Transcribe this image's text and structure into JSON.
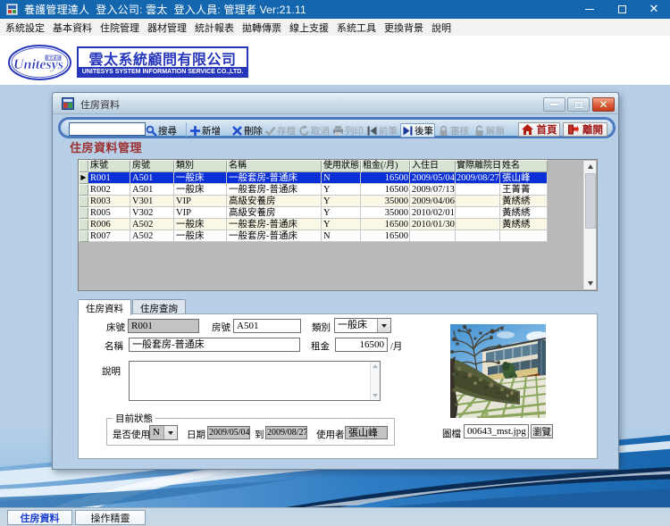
{
  "os": {
    "title": "養護管理達人  登入公司: 雲太  登入人員: 管理者 Ver:21.11",
    "controls": {
      "minimize": "minimize",
      "maximize": "maximize",
      "close": "close"
    }
  },
  "menu": {
    "items": [
      "系統設定",
      "基本資料",
      "住院管理",
      "器材管理",
      "統計報表",
      "拋轉傳票",
      "線上支援",
      "系統工具",
      "更換背景",
      "說明"
    ]
  },
  "brand": {
    "logo_script": "Unitesys",
    "logo_small": "雲太系統",
    "company_zh": "雲太系統顧問有限公司",
    "company_en": "UNITESYS SYSTEM INFORMATION SERVICE CO.,LTD."
  },
  "mdi": {
    "title": "住房資料",
    "heading": "住房資料管理",
    "toolbar": {
      "search": "搜尋",
      "add": "新增",
      "delete": "刪除",
      "save": "存檔",
      "cancel": "取消",
      "print": "列印",
      "prev": "前筆",
      "next": "後筆",
      "audit": "審核",
      "unlock": "解鎖",
      "home": "首頁",
      "exit": "離開"
    }
  },
  "grid": {
    "columns": [
      "床號",
      "房號",
      "類別",
      "名稱",
      "使用狀態",
      "租金(/月)",
      "入住日",
      "實際離院日",
      "姓名"
    ],
    "rows": [
      [
        "R001",
        "A501",
        "一般床",
        "一般套房-普通床",
        "N",
        "16500",
        "2009/05/04",
        "2009/08/27",
        "張山峰"
      ],
      [
        "R002",
        "A501",
        "一般床",
        "一般套房-普通床",
        "Y",
        "16500",
        "2009/07/13",
        "",
        "王菁菁"
      ],
      [
        "R003",
        "V301",
        "VIP",
        "高級安養房",
        "Y",
        "35000",
        "2009/04/06",
        "",
        "黃綉綉"
      ],
      [
        "R005",
        "V302",
        "VIP",
        "高級安養房",
        "Y",
        "35000",
        "2010/02/01",
        "",
        "黃綉綉"
      ],
      [
        "R006",
        "A502",
        "一般床",
        "一般套房-普通床",
        "Y",
        "16500",
        "2010/01/30",
        "",
        "黃綉綉"
      ],
      [
        "R007",
        "A502",
        "一般床",
        "一般套房-普通床",
        "N",
        "16500",
        "",
        "",
        ""
      ]
    ],
    "selected_row": 0,
    "selector_glyph": "▶"
  },
  "tabs": {
    "tab1": "住房資料",
    "tab2": "住房查詢"
  },
  "form": {
    "bed_label": "床號",
    "bed_value": "R001",
    "room_label": "房號",
    "room_value": "A501",
    "type_label": "類別",
    "type_value": "一般床",
    "name_label": "名稱",
    "name_value": "一般套房-普通床",
    "rent_label": "租金",
    "rent_value": "16500",
    "rent_unit": "/月",
    "memo_label": "說明",
    "memo_value": "",
    "status_group": "目前狀態",
    "inuse_label": "是否使用",
    "inuse_value": "N",
    "date_label": "日期",
    "date_from": "2009/05/04",
    "date_to_label": "到",
    "date_to": "2009/08/27",
    "user_label": "使用者",
    "user_value": "張山峰",
    "image_label": "圖檔",
    "image_value": "00643_mst.jpg",
    "browse_label": "瀏覽"
  },
  "taskbar": {
    "tab1": "住房資料",
    "tab2": "操作精靈"
  },
  "colors": {
    "titlebar": "#1467ae",
    "selection": "#0b2fd6",
    "accent_red": "#a01818",
    "header_green": "#d7e3d3",
    "desktop_blue": "#b7cfe7",
    "row_alt": "#fbf7e6"
  }
}
